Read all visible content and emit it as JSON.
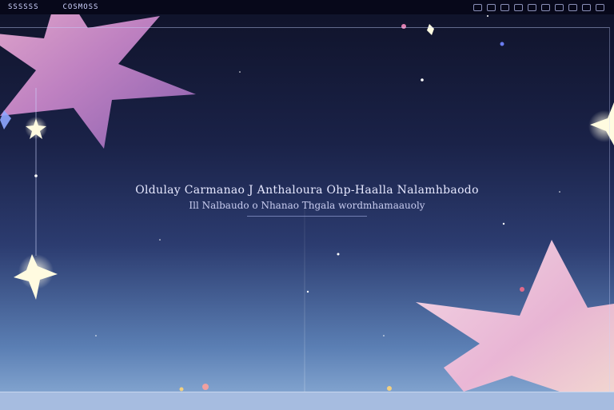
{
  "topbar": {
    "brand": "SSSSSS",
    "brand_secondary": "COSMOSS",
    "icons": [
      "window-icon",
      "window-icon",
      "window-icon",
      "window-icon",
      "window-icon",
      "window-icon",
      "window-icon",
      "window-icon",
      "window-icon",
      "window-icon"
    ]
  },
  "center": {
    "title": "Oldulay Carmanao J Anthaloura Ohp-Haalla Nalamhbaodo",
    "subtitle": "Ill Nalbaudo o Nhanao Thgala wordmhamaauoly"
  },
  "colors": {
    "sky_top": "#0f1228",
    "sky_bottom": "#8fb0d8",
    "star_pink": "#e8a6d8",
    "star_glow": "#fff6d8",
    "bottom_bar": "#a6bce0"
  }
}
